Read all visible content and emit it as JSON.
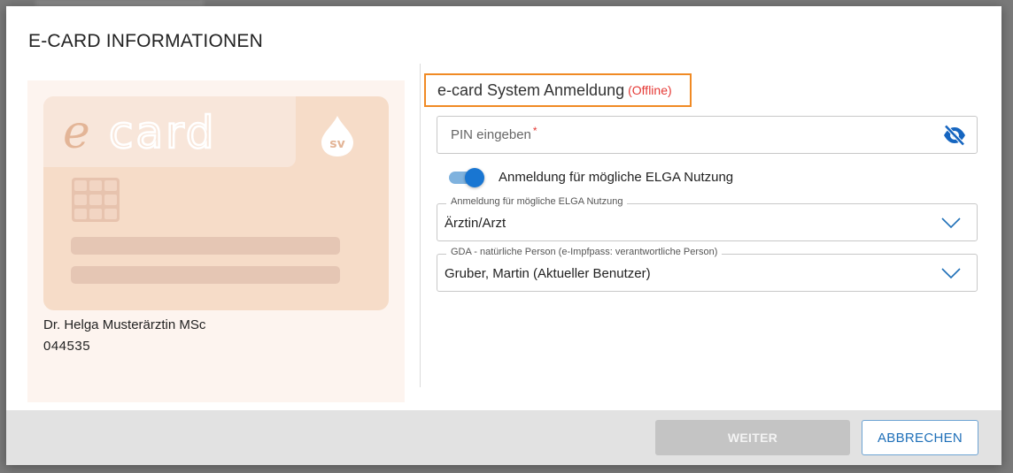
{
  "dialog": {
    "title": "E-CARD INFORMATIONEN"
  },
  "card": {
    "holder_name": "Dr. Helga Musterärztin MSc",
    "holder_number": "044535"
  },
  "login": {
    "heading": "e-card System Anmeldung",
    "status": "(Offline)",
    "pin_placeholder": "PIN eingeben",
    "required_mark": "*",
    "elga_toggle_label": "Anmeldung für mögliche ELGA Nutzung",
    "elga_toggle_on": true,
    "role_label": "Anmeldung für mögliche ELGA Nutzung",
    "role_value": "Ärztin/Arzt",
    "person_label": "GDA - natürliche Person (e-Impfpass: verantwortliche Person)",
    "person_value": "Gruber, Martin (Aktueller Benutzer)"
  },
  "footer": {
    "next_label": "WEITER",
    "cancel_label": "ABBRECHEN"
  },
  "colors": {
    "accent": "#1976d2",
    "highlight_border": "#f08a24",
    "offline": "#e53935",
    "card_bg": "#f6dcc8"
  },
  "icons": {
    "pin_visibility": "eye-off-icon",
    "select_arrow": "chevron-down-icon"
  }
}
